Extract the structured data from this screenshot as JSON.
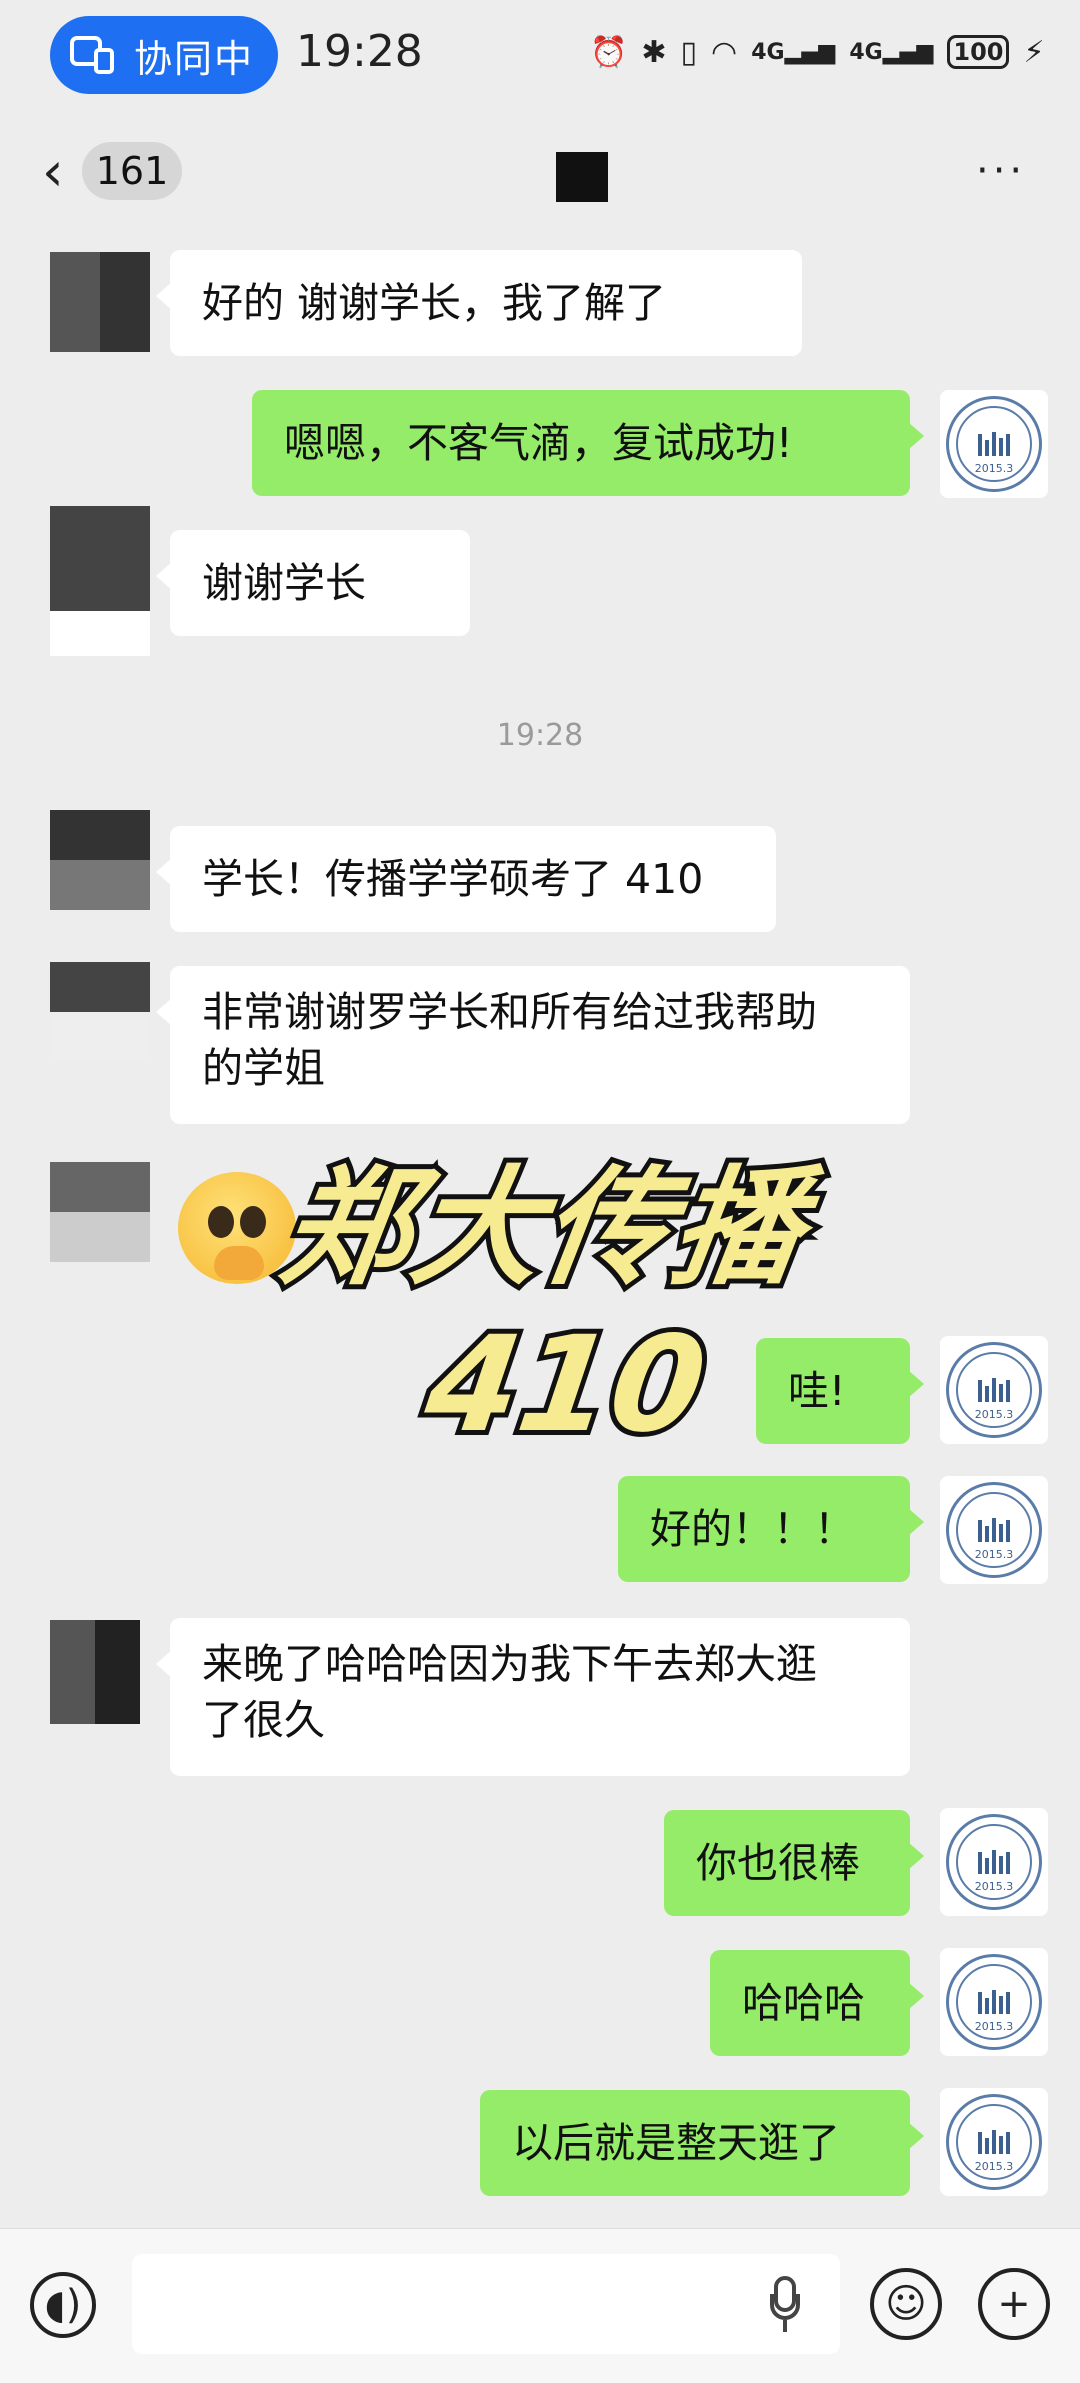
{
  "status_bar": {
    "collab_label": "协同中",
    "time": "19:28",
    "battery": "100",
    "icons": [
      "nfc-icon",
      "alarm-icon",
      "bluetooth-icon",
      "vibrate-icon",
      "wifi-icon",
      "signal-4g-icon",
      "signal-4g-icon",
      "battery-icon",
      "charging-icon"
    ]
  },
  "nav": {
    "back_icon": "back-chevron-icon",
    "unread_count": "161",
    "more_icon": "more-icon"
  },
  "messages": [
    {
      "side": "left",
      "text": "好的 谢谢学长，我了解了"
    },
    {
      "side": "right",
      "text": "嗯嗯，不客气滴，复试成功!"
    },
    {
      "side": "left",
      "text": "谢谢学长"
    },
    {
      "type": "timestamp",
      "text": "19:28"
    },
    {
      "side": "left",
      "text": "学长！传播学学硕考了 410"
    },
    {
      "side": "left",
      "text": "非常谢谢罗学长和所有给过我帮助的学姐"
    },
    {
      "side": "left",
      "type": "sticker",
      "sticker": "pleading-face-emoji"
    },
    {
      "side": "right",
      "text": "哇!"
    },
    {
      "side": "right",
      "text": "好的！！！"
    },
    {
      "side": "left",
      "text": "来晚了哈哈哈因为我下午去郑大逛了很久"
    },
    {
      "side": "right",
      "text": "你也很棒"
    },
    {
      "side": "right",
      "text": "哈哈哈"
    },
    {
      "side": "right",
      "text": "以后就是整天逛了"
    }
  ],
  "msg_lines": {
    "m5a": "非常谢谢罗学长和所有给过我帮助",
    "m5b": "的学姐",
    "m8a": "来晚了哈哈哈因为我下午去郑大逛",
    "m8b": "了很久"
  },
  "avatar_right": {
    "year": "2015.3"
  },
  "overlay": {
    "line1": "郑大传播",
    "line2": "410"
  },
  "input_bar": {
    "voice_icon": "voice-icon",
    "mic_icon": "mic-icon",
    "emoji_icon": "emoji-icon",
    "plus_icon": "plus-icon"
  }
}
